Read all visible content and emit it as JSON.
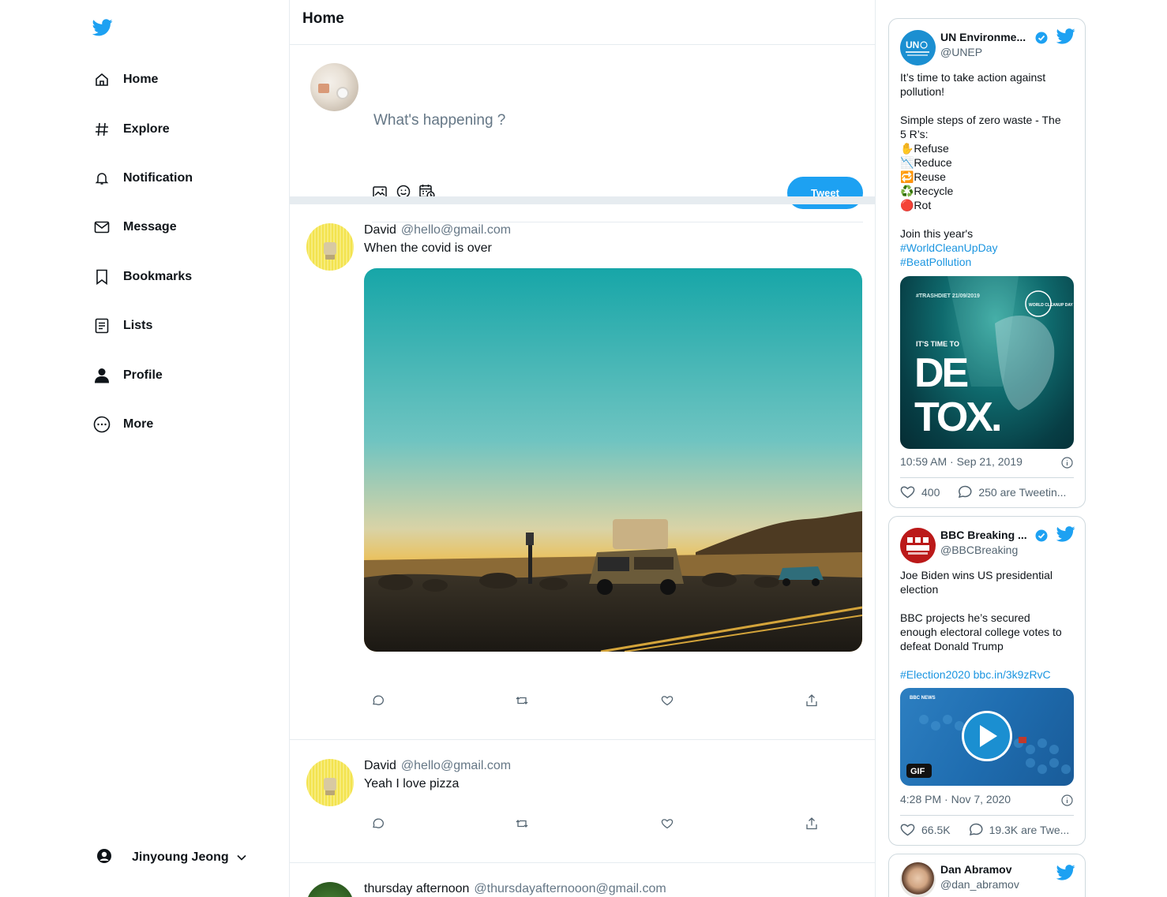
{
  "sidebar": {
    "nav": [
      {
        "label": "Home",
        "icon": "home-icon"
      },
      {
        "label": "Explore",
        "icon": "hashtag-icon"
      },
      {
        "label": "Notification",
        "icon": "bell-icon"
      },
      {
        "label": "Message",
        "icon": "envelope-icon"
      },
      {
        "label": "Bookmarks",
        "icon": "bookmark-icon"
      },
      {
        "label": "Lists",
        "icon": "list-icon"
      },
      {
        "label": "Profile",
        "icon": "person-icon"
      },
      {
        "label": "More",
        "icon": "more-circle-icon"
      }
    ],
    "account_name": "Jinyoung Jeong"
  },
  "main": {
    "title": "Home",
    "compose": {
      "placeholder": "What's happening ?",
      "tweet_button": "Tweet"
    },
    "tweets": [
      {
        "name": "David",
        "handle": "@hello@gmail.com",
        "text": "When the covid is over",
        "has_media": true
      },
      {
        "name": "David",
        "handle": "@hello@gmail.com",
        "text": "Yeah I love pizza",
        "has_media": false
      },
      {
        "name": "thursday afternoon",
        "handle": "@thursdayafternooon@gmail.com",
        "text": "",
        "has_media": false
      }
    ]
  },
  "embeds": [
    {
      "name": "UN Environme...",
      "handle": "@UNEP",
      "lines": [
        "It’s time to take action against",
        "pollution!",
        "",
        "Simple steps of zero waste - The",
        "5 R’s:",
        "✋Refuse",
        "📉Reduce",
        "🔁Reuse",
        "♻️Recycle",
        "🔴Rot",
        "",
        "Join this year's"
      ],
      "hashtags": [
        "#WorldCleanUpDay",
        "#BeatPollution"
      ],
      "media_text": {
        "tag": "#TRASHDIET 21/09/2019",
        "sub": "IT'S TIME TO",
        "big1": "DE",
        "big2": "TOX.",
        "badge": "WORLD CLEANUP DAY"
      },
      "time": "10:59 AM · Sep 21, 2019",
      "likes": "400",
      "replies": "250 are Tweetin..."
    },
    {
      "name": "BBC Breaking ...",
      "handle": "@BBCBreaking",
      "lines": [
        "Joe Biden wins US presidential",
        "election",
        "",
        "BBC projects he’s secured",
        "enough electoral college votes to",
        "defeat Donald Trump",
        ""
      ],
      "link": "#Election2020 bbc.in/3k9zRvC",
      "media_text": {
        "badge": "GIF",
        "brand": "BBC NEWS"
      },
      "time": "4:28 PM · Nov 7, 2020",
      "likes": "66.5K",
      "replies": "19.3K are Twe..."
    },
    {
      "name": "Dan Abramov",
      "handle": "@dan_abramov"
    }
  ],
  "colors": {
    "accent": "#1da1f2",
    "link": "#1b95e0",
    "muted": "#657786",
    "border": "#e6ecf0"
  }
}
